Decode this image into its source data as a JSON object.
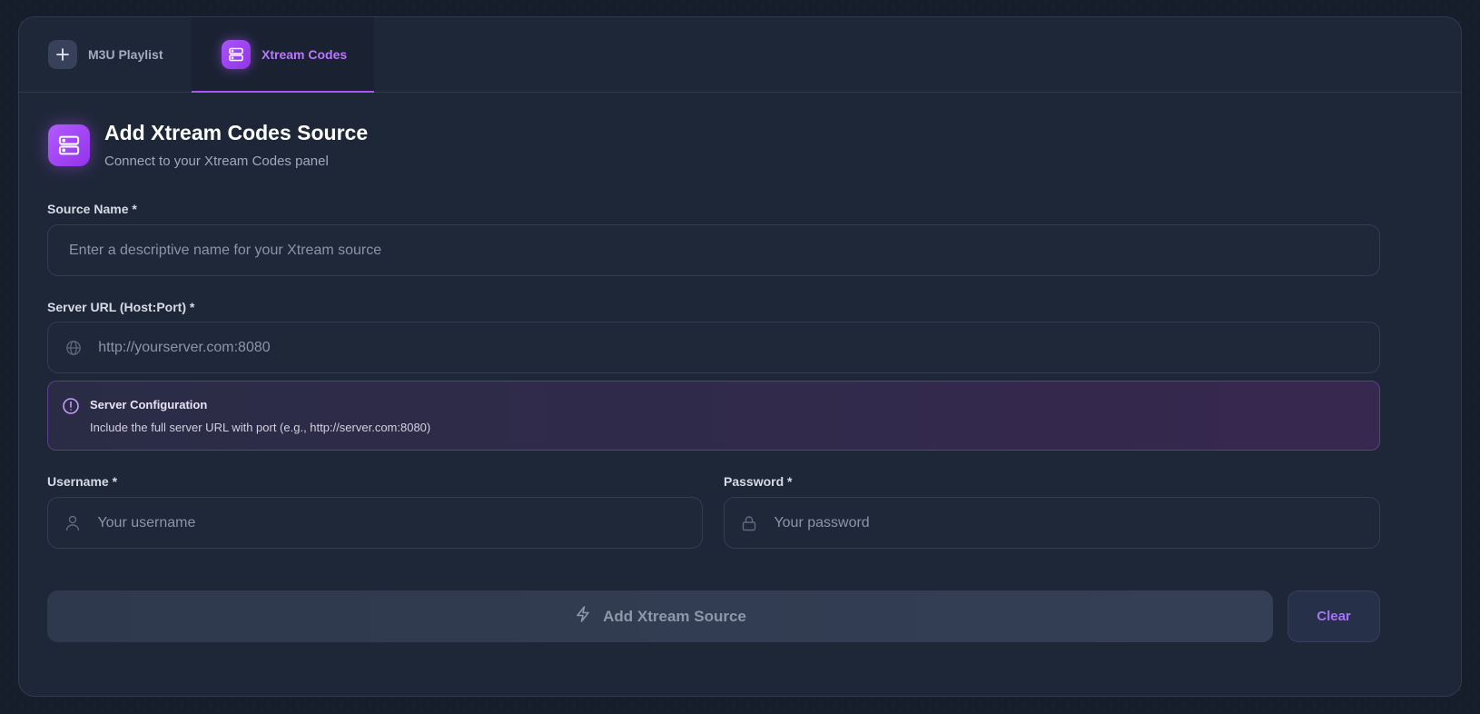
{
  "tabs": [
    {
      "label": "M3U Playlist",
      "icon": "plus-icon",
      "active": false
    },
    {
      "label": "Xtream Codes",
      "icon": "server-icon",
      "active": true
    }
  ],
  "header": {
    "icon": "server-icon",
    "title": "Add Xtream Codes Source",
    "subtitle": "Connect to your Xtream Codes panel"
  },
  "form": {
    "source_name": {
      "label": "Source Name *",
      "placeholder": "Enter a descriptive name for your Xtream source",
      "value": ""
    },
    "server_url": {
      "label": "Server URL (Host:Port) *",
      "placeholder": "http://yourserver.com:8080",
      "value": "",
      "icon": "globe-icon"
    },
    "info": {
      "icon": "info-circle-icon",
      "title": "Server Configuration",
      "text": "Include the full server URL with port (e.g., http://server.com:8080)"
    },
    "username": {
      "label": "Username *",
      "placeholder": "Your username",
      "value": "",
      "icon": "user-icon"
    },
    "password": {
      "label": "Password *",
      "placeholder": "Your password",
      "value": "",
      "icon": "lock-icon"
    }
  },
  "actions": {
    "submit_label": "Add Xtream Source",
    "submit_icon": "lightning-icon",
    "clear_label": "Clear"
  },
  "colors": {
    "accent": "#a855f7",
    "background": "#161d2b",
    "card": "#1e2738",
    "info_border": "#5b3e8c"
  }
}
